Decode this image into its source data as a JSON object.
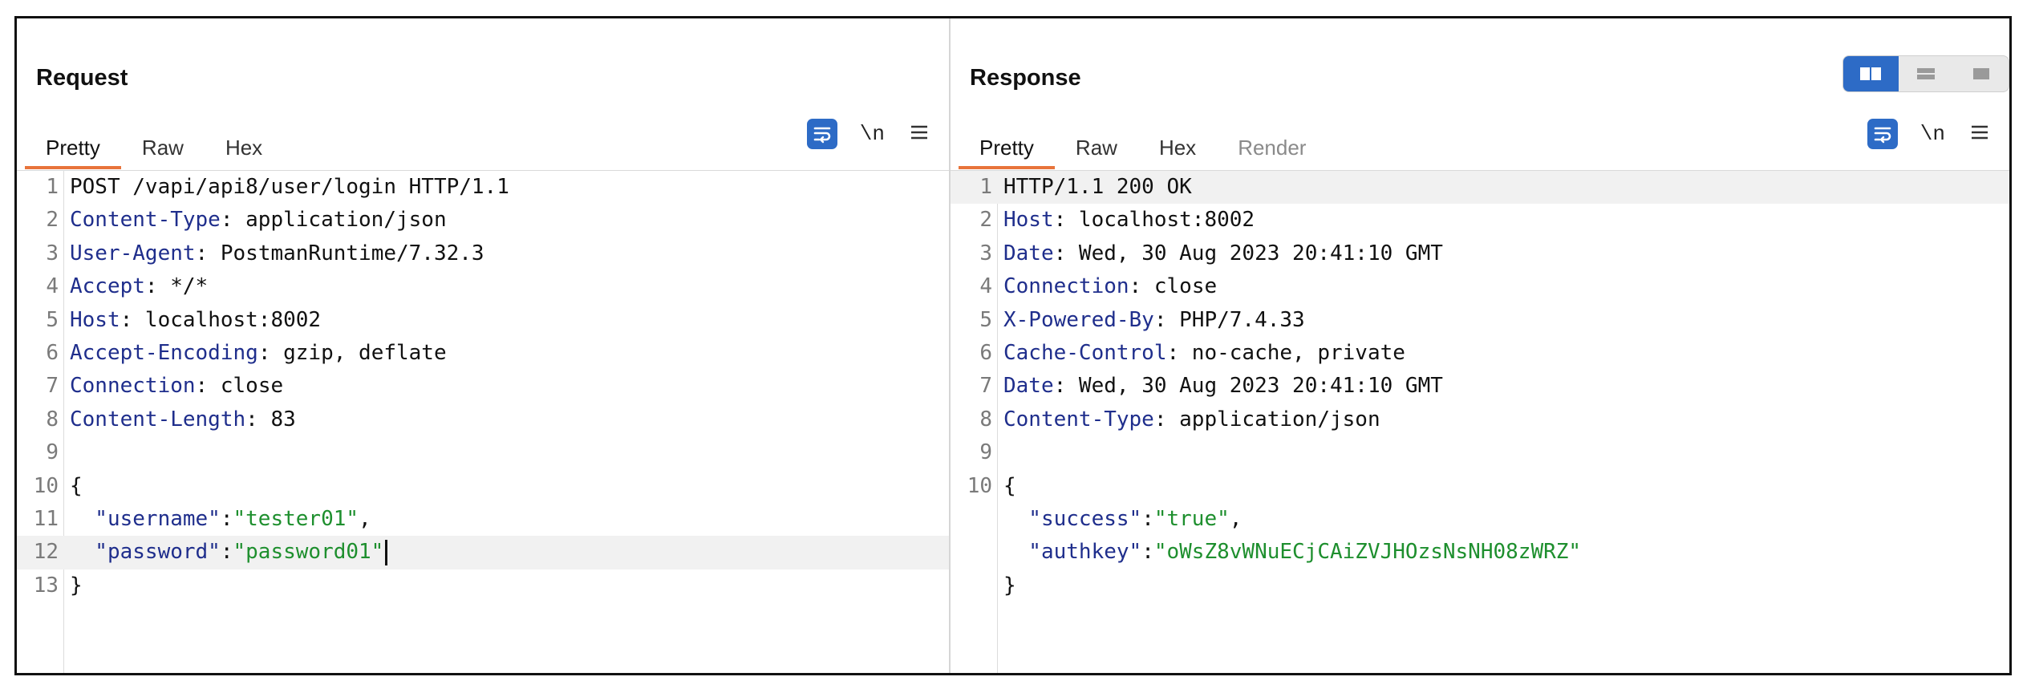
{
  "request": {
    "title": "Request",
    "tabs": [
      {
        "label": "Pretty",
        "active": true
      },
      {
        "label": "Raw"
      },
      {
        "label": "Hex"
      }
    ],
    "tools": {
      "wrap_icon": "text-wrap-icon",
      "newline_label": "\\n",
      "menu_icon": "hamburger-menu-icon"
    },
    "lines": [
      {
        "n": "1",
        "parts": [
          {
            "t": "POST /vapi/api8/user/login HTTP/1.1",
            "c": "plain"
          }
        ]
      },
      {
        "n": "2",
        "parts": [
          {
            "t": "Content-Type",
            "c": "hname"
          },
          {
            "t": ": application/json",
            "c": "plain"
          }
        ]
      },
      {
        "n": "3",
        "parts": [
          {
            "t": "User-Agent",
            "c": "hname"
          },
          {
            "t": ": PostmanRuntime/7.32.3",
            "c": "plain"
          }
        ]
      },
      {
        "n": "4",
        "parts": [
          {
            "t": "Accept",
            "c": "hname"
          },
          {
            "t": ": */*",
            "c": "plain"
          }
        ]
      },
      {
        "n": "5",
        "parts": [
          {
            "t": "Host",
            "c": "hname"
          },
          {
            "t": ": localhost:8002",
            "c": "plain"
          }
        ]
      },
      {
        "n": "6",
        "parts": [
          {
            "t": "Accept-Encoding",
            "c": "hname"
          },
          {
            "t": ": gzip, deflate",
            "c": "plain"
          }
        ]
      },
      {
        "n": "7",
        "parts": [
          {
            "t": "Connection",
            "c": "hname"
          },
          {
            "t": ": close",
            "c": "plain"
          }
        ]
      },
      {
        "n": "8",
        "parts": [
          {
            "t": "Content-Length",
            "c": "hname"
          },
          {
            "t": ": 83",
            "c": "plain"
          }
        ]
      },
      {
        "n": "9",
        "parts": []
      },
      {
        "n": "10",
        "parts": [
          {
            "t": "{",
            "c": "plain"
          }
        ]
      },
      {
        "n": "11",
        "parts": [
          {
            "t": "  \"username\"",
            "c": "hname"
          },
          {
            "t": ":",
            "c": "plain"
          },
          {
            "t": "\"tester01\"",
            "c": "jstr"
          },
          {
            "t": ",",
            "c": "plain"
          }
        ]
      },
      {
        "n": "12",
        "highlight": true,
        "cursor": true,
        "parts": [
          {
            "t": "  \"password\"",
            "c": "hname"
          },
          {
            "t": ":",
            "c": "plain"
          },
          {
            "t": "\"password01\"",
            "c": "jstr"
          }
        ]
      },
      {
        "n": "13",
        "parts": [
          {
            "t": "}",
            "c": "plain"
          }
        ]
      }
    ]
  },
  "response": {
    "title": "Response",
    "tabs": [
      {
        "label": "Pretty",
        "active": true
      },
      {
        "label": "Raw"
      },
      {
        "label": "Hex"
      },
      {
        "label": "Render",
        "disabled": true
      }
    ],
    "tools": {
      "wrap_icon": "text-wrap-icon",
      "newline_label": "\\n",
      "menu_icon": "hamburger-menu-icon"
    },
    "lines": [
      {
        "n": "1",
        "highlight": true,
        "parts": [
          {
            "t": "HTTP/1.1 200 OK",
            "c": "plain"
          }
        ]
      },
      {
        "n": "2",
        "parts": [
          {
            "t": "Host",
            "c": "hname"
          },
          {
            "t": ": localhost:8002",
            "c": "plain"
          }
        ]
      },
      {
        "n": "3",
        "parts": [
          {
            "t": "Date",
            "c": "hname"
          },
          {
            "t": ": Wed, 30 Aug 2023 20:41:10 GMT",
            "c": "plain"
          }
        ]
      },
      {
        "n": "4",
        "parts": [
          {
            "t": "Connection",
            "c": "hname"
          },
          {
            "t": ": close",
            "c": "plain"
          }
        ]
      },
      {
        "n": "5",
        "parts": [
          {
            "t": "X-Powered-By",
            "c": "hname"
          },
          {
            "t": ": PHP/7.4.33",
            "c": "plain"
          }
        ]
      },
      {
        "n": "6",
        "parts": [
          {
            "t": "Cache-Control",
            "c": "hname"
          },
          {
            "t": ": no-cache, private",
            "c": "plain"
          }
        ]
      },
      {
        "n": "7",
        "parts": [
          {
            "t": "Date",
            "c": "hname"
          },
          {
            "t": ": Wed, 30 Aug 2023 20:41:10 GMT",
            "c": "plain"
          }
        ]
      },
      {
        "n": "8",
        "parts": [
          {
            "t": "Content-Type",
            "c": "hname"
          },
          {
            "t": ": application/json",
            "c": "plain"
          }
        ]
      },
      {
        "n": "9",
        "parts": []
      },
      {
        "n": "10",
        "parts": [
          {
            "t": "{",
            "c": "plain"
          }
        ]
      },
      {
        "n": "",
        "parts": [
          {
            "t": "  \"success\"",
            "c": "hname"
          },
          {
            "t": ":",
            "c": "plain"
          },
          {
            "t": "\"true\"",
            "c": "jstr"
          },
          {
            "t": ",",
            "c": "plain"
          }
        ]
      },
      {
        "n": "",
        "parts": [
          {
            "t": "  \"authkey\"",
            "c": "hname"
          },
          {
            "t": ":",
            "c": "plain"
          },
          {
            "t": "\"oWsZ8vWNuECjCAiZVJHOzsNsNH08zWRZ\"",
            "c": "jstr"
          }
        ]
      },
      {
        "n": "",
        "parts": [
          {
            "t": "}",
            "c": "plain"
          }
        ]
      }
    ]
  },
  "layout_toggle": {
    "options": [
      "split-horizontal-icon",
      "split-vertical-icon",
      "single-panel-icon"
    ],
    "active_index": 0
  },
  "colors": {
    "accent": "#2d6bc6",
    "tab_underline": "#e8743b",
    "header_name": "#1f2e8c",
    "json_string": "#1e8f2e"
  }
}
